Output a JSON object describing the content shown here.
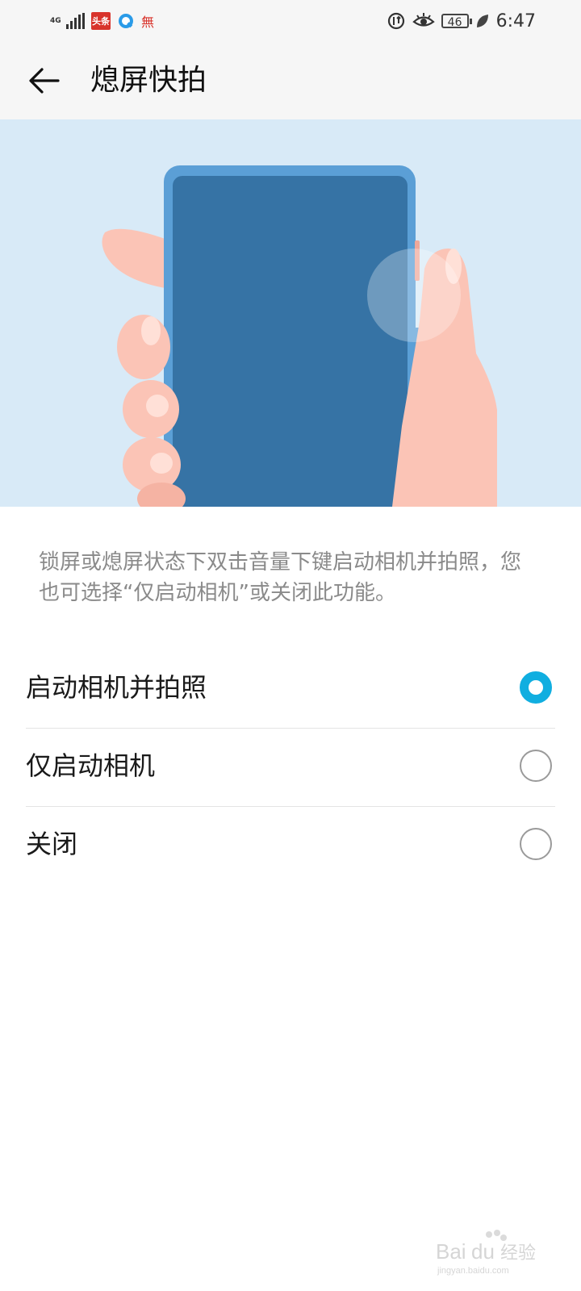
{
  "status_bar": {
    "network": "4G",
    "app_badge": "头条",
    "app_wu": "無",
    "battery": "46",
    "time": "6:47",
    "icons": [
      "signal-icon",
      "toutiao-app-icon",
      "q-app-icon",
      "wu-app-icon",
      "data-saver-icon",
      "eye-comfort-icon",
      "battery-icon",
      "leaf-icon"
    ]
  },
  "header": {
    "back_icon": "arrow-left-icon",
    "title": "熄屏快拍"
  },
  "description": "锁屏或熄屏状态下双击音量下键启动相机并拍照，您也可选择“仅启动相机”或关闭此功能。",
  "options": [
    {
      "label": "启动相机并拍照",
      "selected": true
    },
    {
      "label": "仅启动相机",
      "selected": false
    },
    {
      "label": "关闭",
      "selected": false
    }
  ],
  "colors": {
    "accent": "#10aee0",
    "hero_bg": "#d8eaf7",
    "phone_screen": "#3673a5",
    "phone_frame": "#5b9fd6",
    "skin": "#fbc4b6"
  },
  "watermark": {
    "brand": "Baidu经验",
    "url": "jingyan.baidu.com"
  }
}
